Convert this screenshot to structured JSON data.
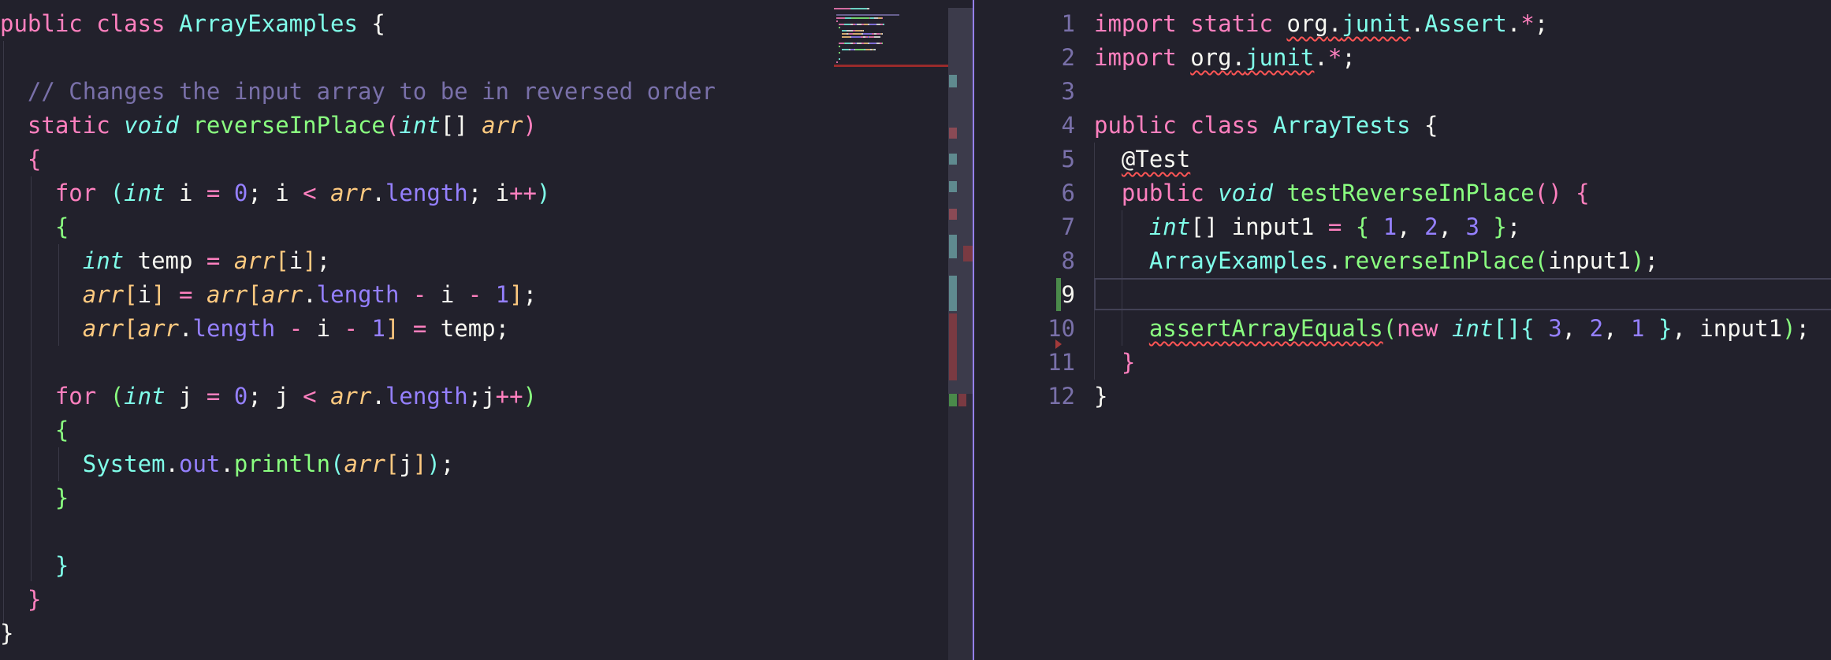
{
  "left_editor": {
    "lines": [
      [
        [
          "public ",
          "kw"
        ],
        [
          "class ",
          "kw"
        ],
        [
          "ArrayExamples",
          "cls"
        ],
        [
          " {",
          "pl"
        ]
      ],
      [],
      [
        [
          "  ",
          "pl"
        ],
        [
          "// Changes the input array to be in reversed order",
          "cm"
        ]
      ],
      [
        [
          "  ",
          "pl"
        ],
        [
          "static ",
          "kw"
        ],
        [
          "void ",
          "ty"
        ],
        [
          "reverseInPlace",
          "fn"
        ],
        [
          "(",
          "b1"
        ],
        [
          "int",
          "ty"
        ],
        [
          "[] ",
          "pl"
        ],
        [
          "arr",
          "par"
        ],
        [
          ")",
          "b1"
        ]
      ],
      [
        [
          "  ",
          "pl"
        ],
        [
          "{",
          "b1"
        ]
      ],
      [
        [
          "    ",
          "pl"
        ],
        [
          "for ",
          "kw"
        ],
        [
          "(",
          "b3"
        ],
        [
          "int ",
          "ty"
        ],
        [
          "i ",
          "pl"
        ],
        [
          "= ",
          "op"
        ],
        [
          "0",
          "num"
        ],
        [
          "; i ",
          "pl"
        ],
        [
          "< ",
          "op"
        ],
        [
          "arr",
          "par"
        ],
        [
          ".",
          "pl"
        ],
        [
          "length",
          "prop"
        ],
        [
          "; i",
          "pl"
        ],
        [
          "++",
          "op"
        ],
        [
          ")",
          "b3"
        ]
      ],
      [
        [
          "    ",
          "pl"
        ],
        [
          "{",
          "b2"
        ]
      ],
      [
        [
          "      ",
          "pl"
        ],
        [
          "int ",
          "ty"
        ],
        [
          "temp ",
          "pl"
        ],
        [
          "= ",
          "op"
        ],
        [
          "arr",
          "par"
        ],
        [
          "[",
          "b4"
        ],
        [
          "i",
          "pl"
        ],
        [
          "]",
          "b4"
        ],
        [
          ";",
          "pl"
        ]
      ],
      [
        [
          "      ",
          "pl"
        ],
        [
          "arr",
          "par"
        ],
        [
          "[",
          "b4"
        ],
        [
          "i",
          "pl"
        ],
        [
          "]",
          "b4"
        ],
        [
          " = ",
          "op"
        ],
        [
          "arr",
          "par"
        ],
        [
          "[",
          "b4"
        ],
        [
          "arr",
          "par"
        ],
        [
          ".",
          "pl"
        ],
        [
          "length ",
          "prop"
        ],
        [
          "- ",
          "op"
        ],
        [
          "i ",
          "pl"
        ],
        [
          "- ",
          "op"
        ],
        [
          "1",
          "num"
        ],
        [
          "]",
          "b4"
        ],
        [
          ";",
          "pl"
        ]
      ],
      [
        [
          "      ",
          "pl"
        ],
        [
          "arr",
          "par"
        ],
        [
          "[",
          "b4"
        ],
        [
          "arr",
          "par"
        ],
        [
          ".",
          "pl"
        ],
        [
          "length ",
          "prop"
        ],
        [
          "- ",
          "op"
        ],
        [
          "i ",
          "pl"
        ],
        [
          "- ",
          "op"
        ],
        [
          "1",
          "num"
        ],
        [
          "]",
          "b4"
        ],
        [
          " = ",
          "op"
        ],
        [
          "temp;",
          "pl"
        ]
      ],
      [],
      [
        [
          "    ",
          "pl"
        ],
        [
          "for ",
          "kw"
        ],
        [
          "(",
          "b2"
        ],
        [
          "int ",
          "ty"
        ],
        [
          "j ",
          "pl"
        ],
        [
          "= ",
          "op"
        ],
        [
          "0",
          "num"
        ],
        [
          "; j ",
          "pl"
        ],
        [
          "< ",
          "op"
        ],
        [
          "arr",
          "par"
        ],
        [
          ".",
          "pl"
        ],
        [
          "length",
          "prop"
        ],
        [
          ";j",
          "pl"
        ],
        [
          "++",
          "op"
        ],
        [
          ")",
          "b2"
        ]
      ],
      [
        [
          "    ",
          "pl"
        ],
        [
          "{",
          "b2"
        ]
      ],
      [
        [
          "      ",
          "pl"
        ],
        [
          "System",
          "cls"
        ],
        [
          ".",
          "pl"
        ],
        [
          "out",
          "prop"
        ],
        [
          ".",
          "pl"
        ],
        [
          "println",
          "fn"
        ],
        [
          "(",
          "b3"
        ],
        [
          "arr",
          "par"
        ],
        [
          "[",
          "b4"
        ],
        [
          "j",
          "pl"
        ],
        [
          "]",
          "b4"
        ],
        [
          ")",
          "b3"
        ],
        [
          ";",
          "pl"
        ]
      ],
      [
        [
          "    ",
          "pl"
        ],
        [
          "}",
          "b2"
        ]
      ],
      [],
      [
        [
          "    ",
          "pl"
        ],
        [
          "}",
          "b3"
        ]
      ],
      [
        [
          "  ",
          "pl"
        ],
        [
          "}",
          "b1"
        ]
      ],
      [
        [
          "}",
          "pl"
        ]
      ]
    ]
  },
  "right_editor": {
    "line_numbers": [
      "1",
      "2",
      "3",
      "4",
      "5",
      "6",
      "7",
      "8",
      "9",
      "10",
      "11",
      "12"
    ],
    "active_line": "9",
    "lines": [
      [
        [
          "import ",
          "kw"
        ],
        [
          "static ",
          "kw"
        ],
        [
          "org",
          "pl",
          "squig"
        ],
        [
          ".",
          "pl",
          "squig"
        ],
        [
          "junit",
          "cls",
          "squig"
        ],
        [
          ".",
          "pl"
        ],
        [
          "Assert",
          "cls"
        ],
        [
          ".",
          "pl"
        ],
        [
          "*",
          "op"
        ],
        [
          ";",
          "pl"
        ]
      ],
      [
        [
          "import ",
          "kw"
        ],
        [
          "org",
          "pl",
          "squig"
        ],
        [
          ".",
          "pl",
          "squig"
        ],
        [
          "junit",
          "cls",
          "squig"
        ],
        [
          ".",
          "pl"
        ],
        [
          "*",
          "op"
        ],
        [
          ";",
          "pl"
        ]
      ],
      [],
      [
        [
          "public ",
          "kw"
        ],
        [
          "class ",
          "kw"
        ],
        [
          "ArrayTests",
          "cls"
        ],
        [
          " {",
          "pl"
        ]
      ],
      [
        [
          "  ",
          "pl"
        ],
        [
          "@Test",
          "pl",
          "squig"
        ]
      ],
      [
        [
          "  ",
          "pl"
        ],
        [
          "public ",
          "kw"
        ],
        [
          "void ",
          "ty"
        ],
        [
          "testReverseInPlace",
          "fn"
        ],
        [
          "() {",
          "b1"
        ]
      ],
      [
        [
          "    ",
          "pl"
        ],
        [
          "int",
          "ty"
        ],
        [
          "[] input1 ",
          "pl"
        ],
        [
          "= ",
          "op"
        ],
        [
          "{ ",
          "b2"
        ],
        [
          "1",
          "num"
        ],
        [
          ", ",
          "pl"
        ],
        [
          "2",
          "num"
        ],
        [
          ", ",
          "pl"
        ],
        [
          "3",
          "num"
        ],
        [
          " }",
          "b2"
        ],
        [
          ";",
          "pl"
        ]
      ],
      [
        [
          "    ",
          "pl"
        ],
        [
          "ArrayExamples",
          "cls"
        ],
        [
          ".",
          "pl"
        ],
        [
          "reverseInPlace",
          "fn"
        ],
        [
          "(",
          "b2"
        ],
        [
          "input1",
          "pl"
        ],
        [
          ")",
          "b2"
        ],
        [
          ";",
          "pl"
        ]
      ],
      [],
      [
        [
          "    ",
          "pl"
        ],
        [
          "assertArrayEquals",
          "fn",
          "squig"
        ],
        [
          "(",
          "b2"
        ],
        [
          "new ",
          "kw"
        ],
        [
          "int",
          "ty"
        ],
        [
          "[]",
          "b3"
        ],
        [
          "{ ",
          "b3"
        ],
        [
          "3",
          "num"
        ],
        [
          ", ",
          "pl"
        ],
        [
          "2",
          "num"
        ],
        [
          ", ",
          "pl"
        ],
        [
          "1",
          "num"
        ],
        [
          " }",
          "b3"
        ],
        [
          ", input1",
          "pl"
        ],
        [
          ")",
          "b2"
        ],
        [
          ";",
          "pl"
        ]
      ],
      [
        [
          "  ",
          "pl"
        ],
        [
          "}",
          "b1"
        ]
      ],
      [
        [
          "}",
          "pl"
        ]
      ]
    ]
  },
  "colors": {
    "background": "#22212c",
    "keyword": "#ff80bf",
    "class": "#80ffea",
    "function": "#8aff80",
    "parameter": "#ffca80",
    "number": "#9580ff",
    "comment": "#7970a9",
    "split_divider": "#9580ff",
    "error_squiggle": "#ff5555"
  }
}
